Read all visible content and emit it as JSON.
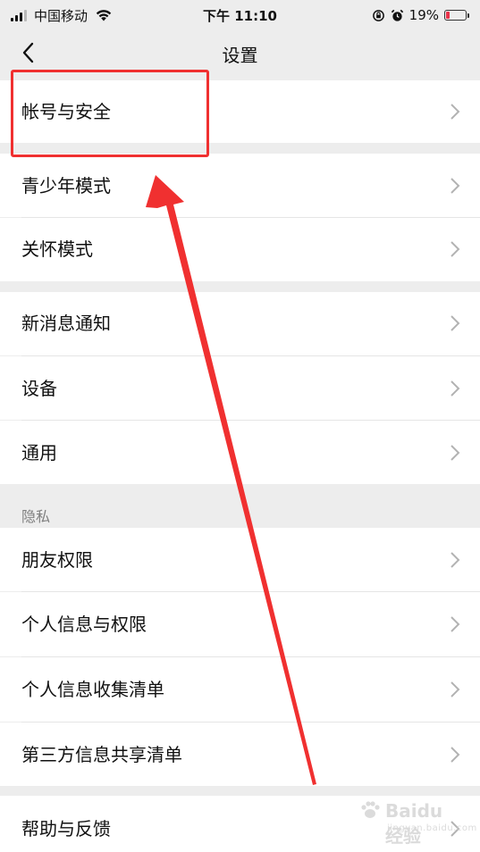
{
  "status_bar": {
    "carrier": "中国移动",
    "time": "下午 11:10",
    "battery_percent": "19%",
    "battery_level": 0.19,
    "battery_color": "#e8334a"
  },
  "nav": {
    "title": "设置",
    "back_icon": "chevron-left-icon"
  },
  "settings": {
    "account_security": "帐号与安全",
    "youth_mode": "青少年模式",
    "care_mode": "关怀模式",
    "new_message_notify": "新消息通知",
    "devices": "设备",
    "general": "通用",
    "privacy_group": "隐私",
    "friend_permissions": "朋友权限",
    "personal_info_permissions": "个人信息与权限",
    "personal_info_collection": "个人信息收集清单",
    "third_party_sharing": "第三方信息共享清单",
    "help_feedback": "帮助与反馈"
  },
  "annotation": {
    "color": "#f03030"
  },
  "watermark": {
    "text": "Baidu经验",
    "url": "jingyan.baidu.com"
  }
}
